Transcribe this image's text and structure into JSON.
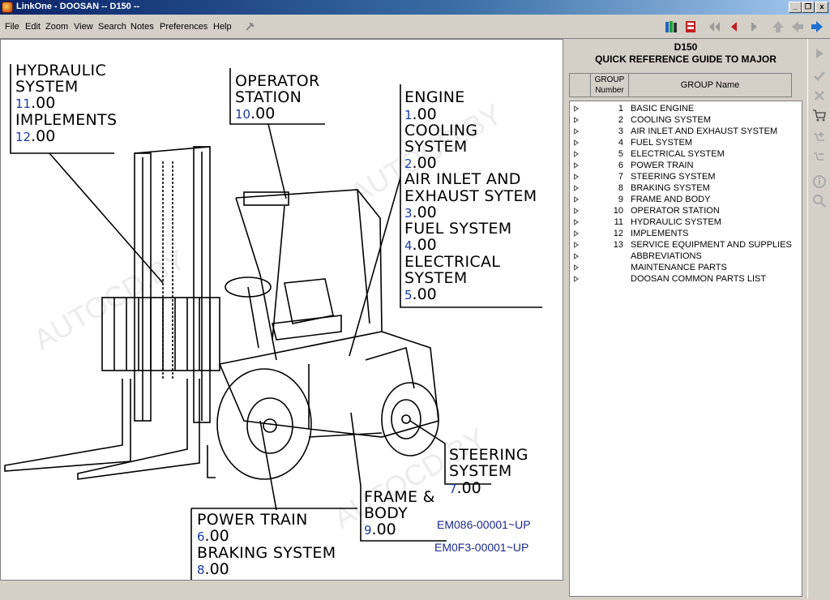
{
  "window": {
    "title": "LinkOne - DOOSAN -- D150 --",
    "controls": [
      "_",
      "❐",
      "x"
    ]
  },
  "menu": [
    "File",
    "Edit",
    "Zoom",
    "View",
    "Search",
    "Notes",
    "Preferences",
    "Help"
  ],
  "toolbar_icons": [
    "pin-icon",
    "books-icon",
    "bookmark-icon",
    "first-page-icon",
    "previous-icon",
    "next-icon",
    "up-icon",
    "back-icon",
    "forward-icon"
  ],
  "drawing": {
    "labels": [
      {
        "id": "hydraulic",
        "text": "HYDRAULIC",
        "text2": "SYSTEM",
        "code_num": "11",
        "code_rest": ".00"
      },
      {
        "id": "implements",
        "text": "IMPLEMENTS",
        "code_num": "12",
        "code_rest": ".00"
      },
      {
        "id": "operator",
        "text": "OPERATOR",
        "text2": "STATION",
        "code_num": "10",
        "code_rest": ".00"
      },
      {
        "id": "engine",
        "text": "ENGINE",
        "code_num": "1",
        "code_rest": ".00"
      },
      {
        "id": "cooling",
        "text": "COOLING",
        "text2": "SYSTEM",
        "code_num": "2",
        "code_rest": ".00"
      },
      {
        "id": "airinlet",
        "text": "AIR INLET AND",
        "text2": "EXHAUST SYTEM",
        "code_num": "3",
        "code_rest": ".00"
      },
      {
        "id": "fuel",
        "text": "FUEL SYSTEM",
        "code_num": "4",
        "code_rest": ".00"
      },
      {
        "id": "electrical",
        "text": "ELECTRICAL",
        "text2": "SYSTEM",
        "code_num": "5",
        "code_rest": ".00"
      },
      {
        "id": "steering",
        "text": "STEERING",
        "text2": "SYSTEM",
        "code_num": "7",
        "code_rest": ".00"
      },
      {
        "id": "frame",
        "text": "FRAME &",
        "text2": "BODY",
        "code_num": "9",
        "code_rest": ".00"
      },
      {
        "id": "powertrain",
        "text": "POWER TRAIN",
        "code_num": "6",
        "code_rest": ".00"
      },
      {
        "id": "braking",
        "text": "BRAKING SYSTEM",
        "code_num": "8",
        "code_rest": ".00"
      }
    ],
    "serials": [
      "EM086-00001~UP",
      "EM0F3-00001~UP"
    ],
    "watermark": "AUTOCD.BY"
  },
  "panel": {
    "model": "D150",
    "title": "QUICK REFERENCE GUIDE TO MAJOR",
    "col_group_number_1": "GROUP",
    "col_group_number_2": "Number",
    "col_group_name": "GROUP Name",
    "rows": [
      {
        "num": "1",
        "name": "BASIC ENGINE"
      },
      {
        "num": "2",
        "name": "COOLING SYSTEM"
      },
      {
        "num": "3",
        "name": "AIR INLET AND EXHAUST SYSTEM"
      },
      {
        "num": "4",
        "name": "FUEL SYSTEM"
      },
      {
        "num": "5",
        "name": "ELECTRICAL SYSTEM"
      },
      {
        "num": "6",
        "name": "POWER TRAIN"
      },
      {
        "num": "7",
        "name": "STEERING SYSTEM"
      },
      {
        "num": "8",
        "name": "BRAKING SYSTEM"
      },
      {
        "num": "9",
        "name": "FRAME AND BODY"
      },
      {
        "num": "10",
        "name": "OPERATOR STATION"
      },
      {
        "num": "11",
        "name": "HYDRAULIC SYSTEM"
      },
      {
        "num": "12",
        "name": "IMPLEMENTS"
      },
      {
        "num": "13",
        "name": "SERVICE EQUIPMENT AND SUPPLIES"
      },
      {
        "num": "",
        "name": "ABBREVIATIONS"
      },
      {
        "num": "",
        "name": "MAINTENANCE PARTS"
      },
      {
        "num": "",
        "name": "DOOSAN COMMON PARTS LIST"
      }
    ]
  },
  "side_icons": [
    "play-icon",
    "check-icon",
    "close-icon",
    "cart-icon",
    "cart-add-icon",
    "cart-remove-icon",
    "info-icon",
    "zoom-icon"
  ]
}
